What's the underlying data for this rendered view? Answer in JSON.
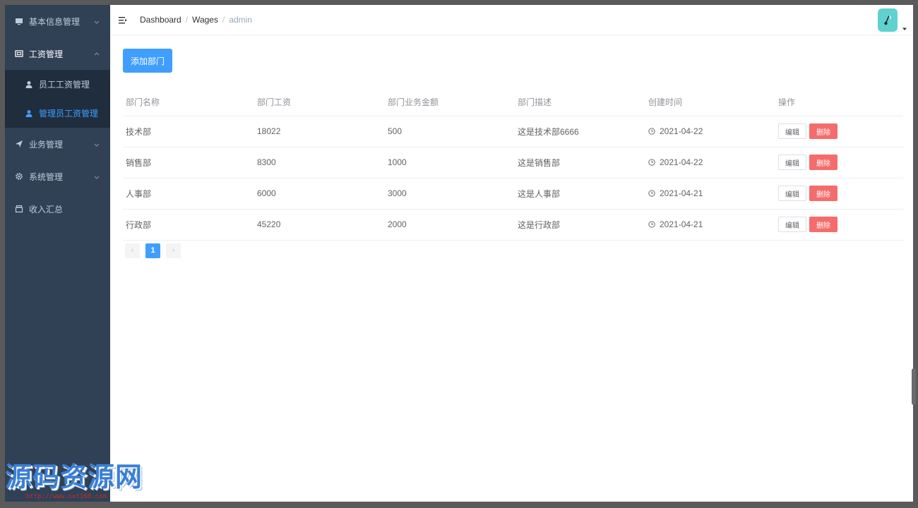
{
  "sidebar": {
    "items": [
      {
        "label": "基本信息管理",
        "icon": "monitor-icon"
      },
      {
        "label": "工资管理",
        "icon": "wallet-icon"
      },
      {
        "label": "员工工资管理",
        "icon": "user-icon"
      },
      {
        "label": "管理员工资管理",
        "icon": "user-icon"
      },
      {
        "label": "业务管理",
        "icon": "send-icon"
      },
      {
        "label": "系统管理",
        "icon": "gear-icon"
      },
      {
        "label": "收入汇总",
        "icon": "box-icon"
      }
    ]
  },
  "header": {
    "breadcrumb": [
      "Dashboard",
      "Wages",
      "admin"
    ]
  },
  "toolbar": {
    "add_label": "添加部门"
  },
  "table": {
    "headers": [
      "部门名称",
      "部门工资",
      "部门业务金额",
      "部门描述",
      "创建时间",
      "操作"
    ],
    "rows": [
      {
        "name": "技术部",
        "wage": "18022",
        "amount": "500",
        "desc": "这是技术部6666",
        "date": "2021-04-22"
      },
      {
        "name": "销售部",
        "wage": "8300",
        "amount": "1000",
        "desc": "这是销售部",
        "date": "2021-04-22"
      },
      {
        "name": "人事部",
        "wage": "6000",
        "amount": "3000",
        "desc": "这是人事部",
        "date": "2021-04-21"
      },
      {
        "name": "行政部",
        "wage": "45220",
        "amount": "2000",
        "desc": "这是行政部",
        "date": "2021-04-21"
      }
    ],
    "edit_label": "编辑",
    "delete_label": "删除"
  },
  "pagination": {
    "prev": "‹",
    "current": "1",
    "next": "›"
  },
  "watermark": {
    "text": "源码资源网",
    "url": "http://www.net188.com"
  },
  "colors": {
    "primary": "#409eff",
    "danger": "#f56c6c",
    "sidebar": "#304156",
    "submenu": "#1f2d3d"
  }
}
